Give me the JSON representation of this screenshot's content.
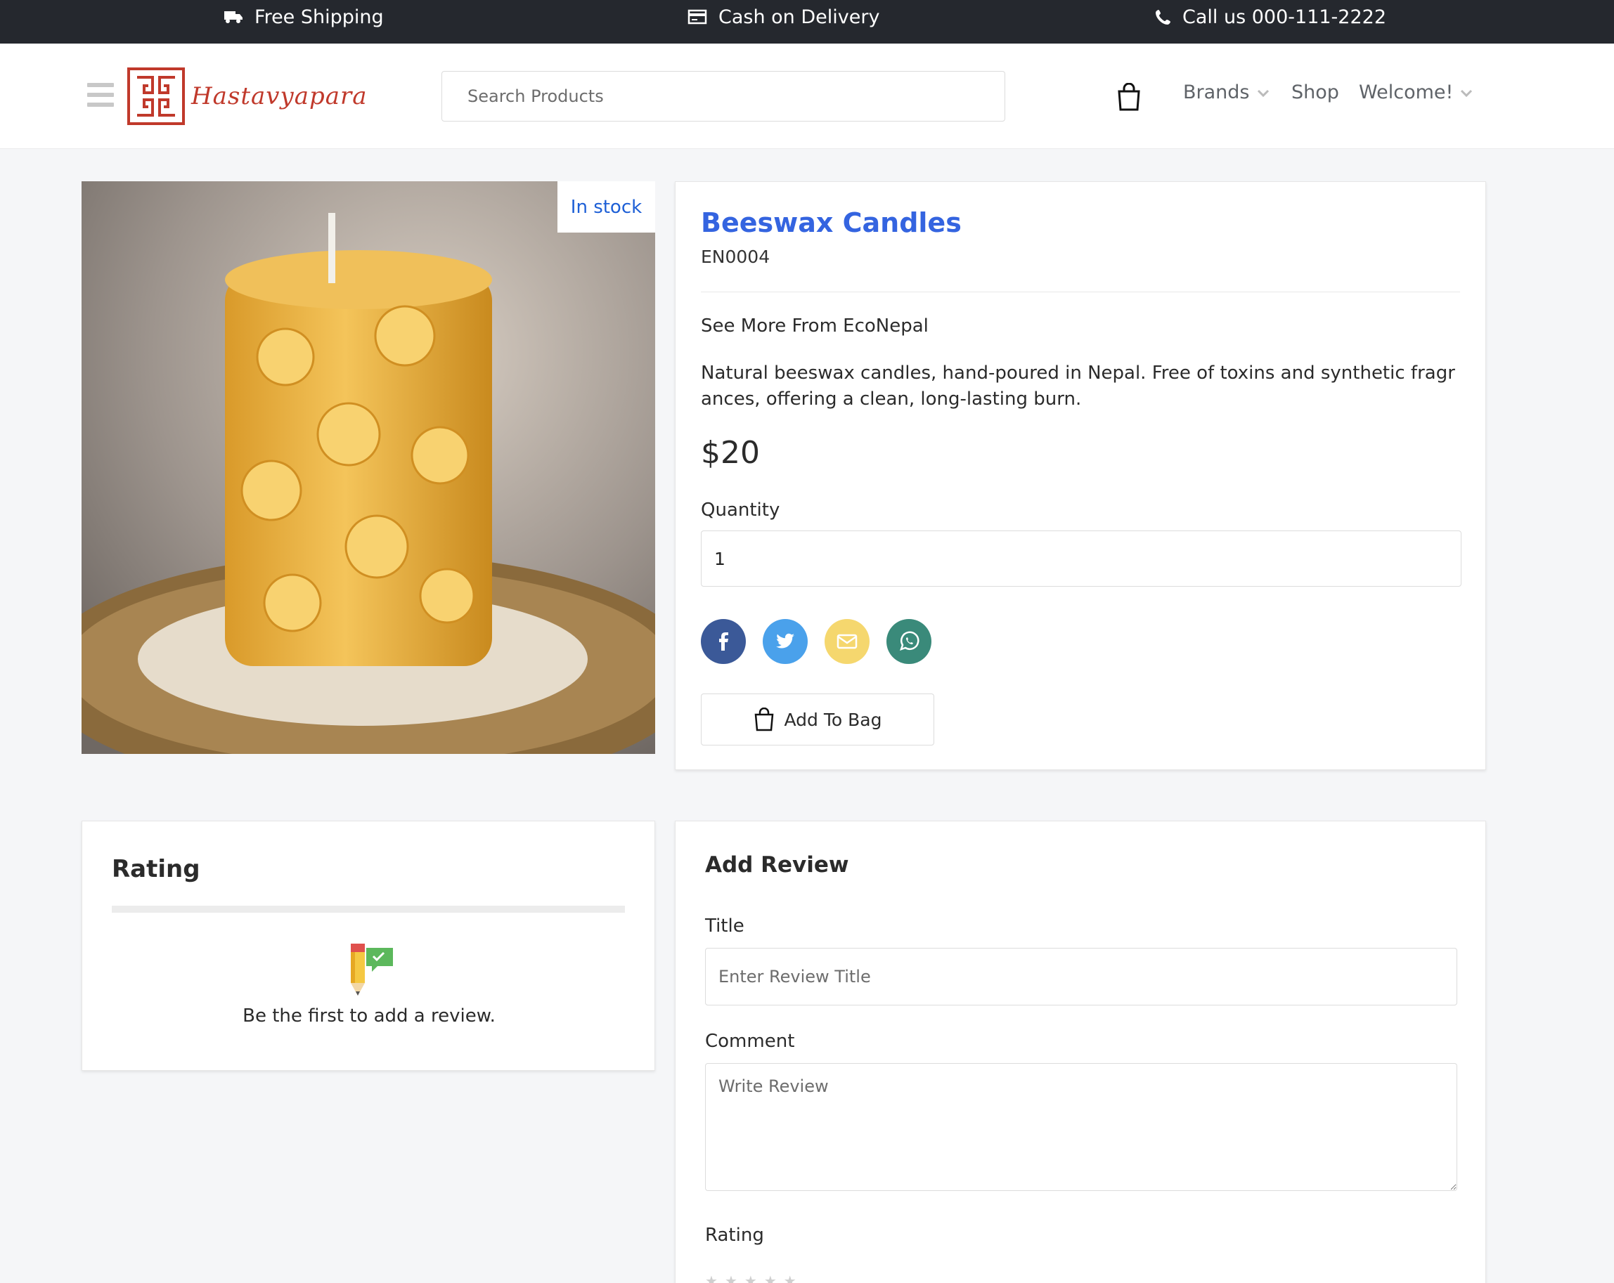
{
  "topbar": {
    "shipping": "Free Shipping",
    "cod": "Cash on Delivery",
    "call": "Call us 000-111-2222"
  },
  "header": {
    "logo_text": "Hastavyapara",
    "search_placeholder": "Search Products",
    "nav": {
      "brands": "Brands",
      "shop": "Shop",
      "welcome": "Welcome!"
    }
  },
  "product": {
    "stock_badge": "In stock",
    "title": "Beeswax Candles",
    "sku": "EN0004",
    "brand_link": "See More From EcoNepal",
    "description": "Natural beeswax candles, hand-poured in Nepal. Free of toxins and synthetic fragrances, offering a clean, long-lasting burn.",
    "price": "$20",
    "quantity_label": "Quantity",
    "quantity_value": "1",
    "add_to_bag": "Add To Bag",
    "share_colors": {
      "facebook": "#3b5998",
      "twitter": "#4aa1eb",
      "email": "#f5d76e",
      "whatsapp": "#3a8a7a"
    }
  },
  "rating": {
    "title": "Rating",
    "empty_message": "Be the first to add a review."
  },
  "add_review": {
    "title": "Add Review",
    "title_label": "Title",
    "title_placeholder": "Enter Review Title",
    "comment_label": "Comment",
    "comment_placeholder": "Write Review",
    "rating_label": "Rating"
  }
}
